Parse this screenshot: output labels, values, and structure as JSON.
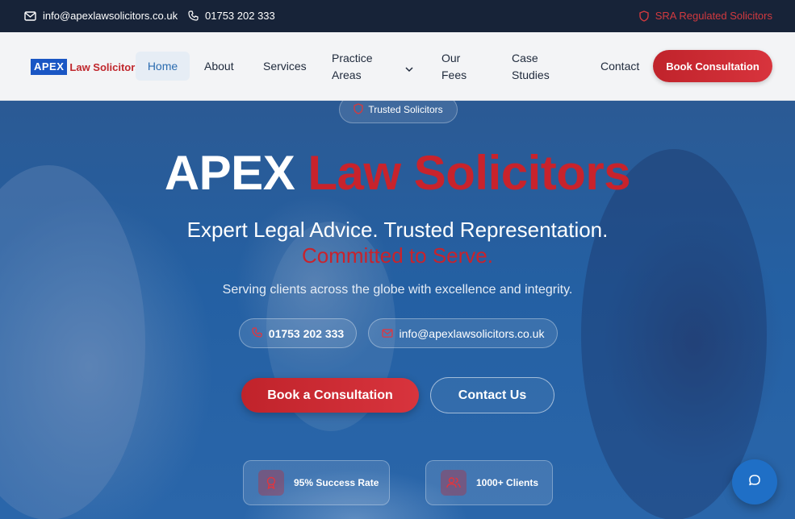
{
  "topbar": {
    "email": "info@apexlawsolicitors.co.uk",
    "phone": "01753 202 333",
    "regulated": "SRA Regulated Solicitors"
  },
  "nav": {
    "logo_apex": "APEX",
    "logo_rest": "Law Solicitors",
    "items": [
      "Home",
      "About",
      "Services",
      "Practice Areas",
      "Our Fees",
      "Case Studies",
      "Contact"
    ],
    "book_button": "Book Consultation"
  },
  "hero": {
    "badge": "Trusted Solicitors",
    "title_white": "APEX",
    "title_red": "Law Solicitors",
    "subtitle": "Expert Legal Advice. Trusted Representation.",
    "subtitle_red": "Committed to Serve.",
    "tagline": "Serving clients across the globe with excellence and integrity.",
    "phone": "01753 202 333",
    "email": "info@apexlawsolicitors.co.uk",
    "primary_button": "Book a Consultation",
    "secondary_button": "Contact Us",
    "stats": [
      "95% Success Rate",
      "1000+ Clients"
    ]
  },
  "colors": {
    "brand_red": "#c8232c",
    "topbar_bg": "#172338",
    "hero_blue": "#2460a3",
    "nav_active": "#2b6cb0"
  },
  "icons": [
    "mail-icon",
    "phone-icon",
    "shield-icon",
    "chevron-down-icon",
    "award-icon",
    "users-icon",
    "chat-icon"
  ]
}
